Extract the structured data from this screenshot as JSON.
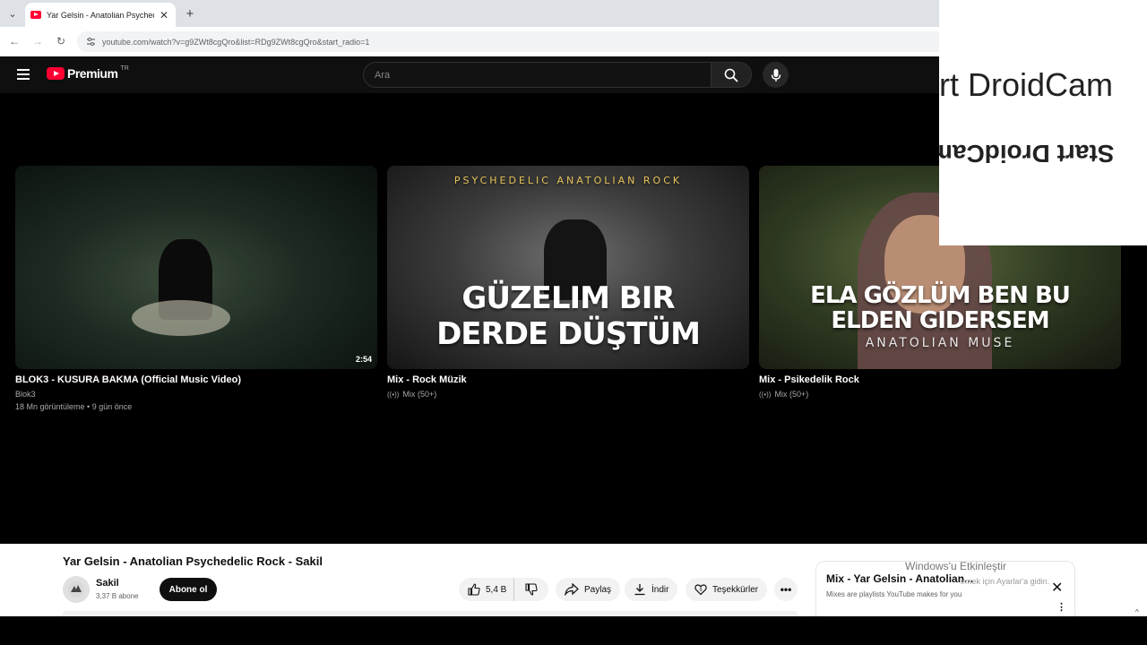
{
  "browser": {
    "tab_title": "Yar Gelsin - Anatolian Psychede",
    "url": "youtube.com/watch?v=g9ZWt8cgQro&list=RDg9ZWt8cgQro&start_radio=1"
  },
  "header": {
    "logo_text": "Premium",
    "logo_country": "TR",
    "search_placeholder": "Ara"
  },
  "droidcam": {
    "line1": "art DroidCam",
    "line2": "Start DroidCam"
  },
  "cards": [
    {
      "title": "BLOK3 - KUSURA BAKMA (Official Music Video)",
      "channel": "Blok3",
      "meta": "18 Mn görüntüleme • 9 gün önce",
      "duration": "2:54"
    },
    {
      "title": "Mix - Rock Müzik",
      "meta": "Mix (50+)",
      "thumb_top": "PSYCHEDELIC ANATOLIAN ROCK",
      "thumb_line1": "GÜZELIM BIR",
      "thumb_line2": "DERDE DÜŞTÜM"
    },
    {
      "title": "Mix - Psikedelik Rock",
      "meta": "Mix (50+)",
      "thumb_line1": "ELA GÖZLÜM BEN BU",
      "thumb_line2": "ELDEN GIDERSEM",
      "thumb_line3": "ANATOLIAN MUSE"
    }
  ],
  "video": {
    "title": "Yar Gelsin - Anatolian Psychedelic Rock - Sakil",
    "channel": "Sakil",
    "subscribers": "3,37 B abone",
    "subscribe_label": "Abone ol",
    "likes": "5,4 B",
    "share_label": "Paylaş",
    "download_label": "İndir",
    "thanks_label": "Teşekkürler"
  },
  "mix_panel": {
    "title": "Mix - Yar Gelsin - Anatolian...",
    "subtitle": "Mixes are playlists YouTube makes for you"
  },
  "windows_watermark": {
    "title": "Windows'u Etkinleştir",
    "subtitle": "irmek için Ayarlar'a gidin."
  },
  "colors": {
    "youtube_red": "#ff0033",
    "page_bg": "#000000",
    "header_bg": "#0f0f0f"
  }
}
